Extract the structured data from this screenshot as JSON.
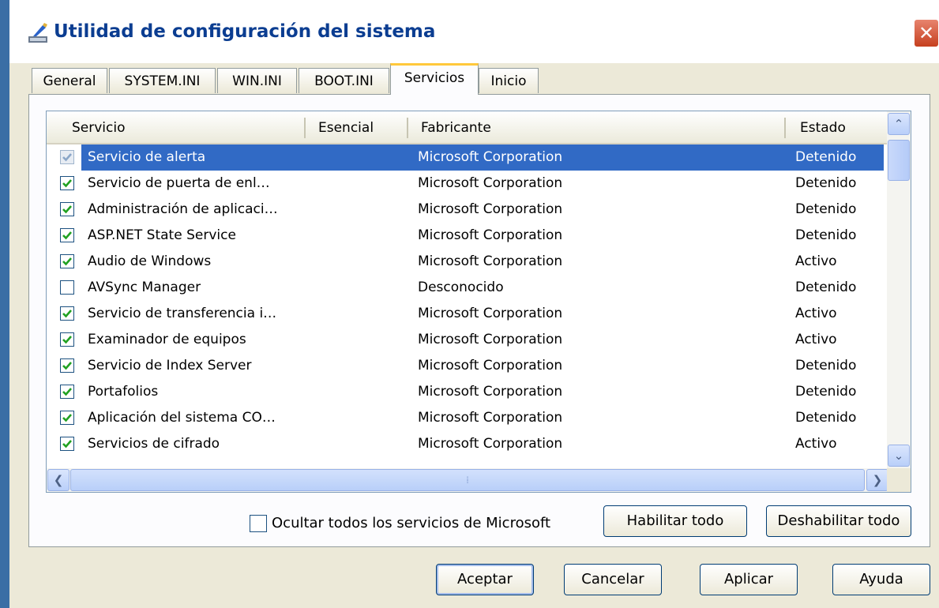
{
  "window": {
    "title": "Utilidad de configuración del sistema",
    "close_symbol": "✕"
  },
  "tabs": [
    {
      "label": "General"
    },
    {
      "label": "SYSTEM.INI"
    },
    {
      "label": "WIN.INI"
    },
    {
      "label": "BOOT.INI"
    },
    {
      "label": "Servicios",
      "active": true
    },
    {
      "label": "Inicio"
    }
  ],
  "services": {
    "columns": [
      "Servicio",
      "Esencial",
      "Fabricante",
      "Estado"
    ],
    "rows": [
      {
        "checked": true,
        "name": "Servicio de alerta",
        "essential": "",
        "vendor": "Microsoft Corporation",
        "status": "Detenido",
        "selected": true
      },
      {
        "checked": true,
        "name": "Servicio de puerta de enl…",
        "essential": "",
        "vendor": "Microsoft Corporation",
        "status": "Detenido"
      },
      {
        "checked": true,
        "name": "Administración de aplicaci…",
        "essential": "",
        "vendor": "Microsoft Corporation",
        "status": "Detenido"
      },
      {
        "checked": true,
        "name": "ASP.NET State Service",
        "essential": "",
        "vendor": "Microsoft Corporation",
        "status": "Detenido"
      },
      {
        "checked": true,
        "name": "Audio de Windows",
        "essential": "",
        "vendor": "Microsoft Corporation",
        "status": "Activo"
      },
      {
        "checked": false,
        "name": "AVSync Manager",
        "essential": "",
        "vendor": "Desconocido",
        "status": "Detenido"
      },
      {
        "checked": true,
        "name": "Servicio de transferencia i…",
        "essential": "",
        "vendor": "Microsoft Corporation",
        "status": "Activo"
      },
      {
        "checked": true,
        "name": "Examinador de equipos",
        "essential": "",
        "vendor": "Microsoft Corporation",
        "status": "Activo"
      },
      {
        "checked": true,
        "name": "Servicio de Index Server",
        "essential": "",
        "vendor": "Microsoft Corporation",
        "status": "Detenido"
      },
      {
        "checked": true,
        "name": "Portafolios",
        "essential": "",
        "vendor": "Microsoft Corporation",
        "status": "Detenido"
      },
      {
        "checked": true,
        "name": "Aplicación del sistema CO…",
        "essential": "",
        "vendor": "Microsoft Corporation",
        "status": "Detenido"
      },
      {
        "checked": true,
        "name": "Servicios de cifrado",
        "essential": "",
        "vendor": "Microsoft Corporation",
        "status": "Activo"
      }
    ]
  },
  "scrollbar": {
    "up_symbol": "⌃",
    "down_symbol": "⌄",
    "left_symbol": "❮",
    "right_symbol": "❯",
    "grip_symbol": "⁞"
  },
  "hide_ms": {
    "label": "Ocultar todos los servicios de Microsoft",
    "checked": false
  },
  "buttons": {
    "enable_all": "Habilitar todo",
    "disable_all": "Deshabilitar todo",
    "ok": "Aceptar",
    "cancel": "Cancelar",
    "apply": "Aplicar",
    "help": "Ayuda"
  },
  "colors": {
    "selection": "#316ac5",
    "title_text": "#0b3d91",
    "close_button": "#c6401f",
    "active_tab_accent": "#ffc83c"
  }
}
